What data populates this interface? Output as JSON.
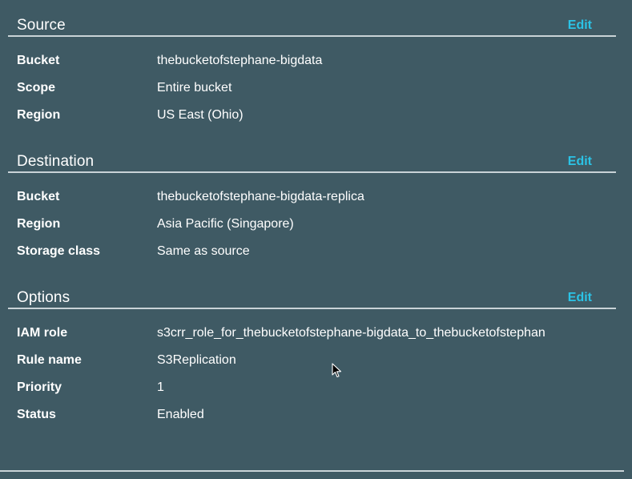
{
  "source": {
    "title": "Source",
    "edit_label": "Edit",
    "rows": [
      {
        "label": "Bucket",
        "value": "thebucketofstephane-bigdata"
      },
      {
        "label": "Scope",
        "value": "Entire bucket"
      },
      {
        "label": "Region",
        "value": "US East (Ohio)"
      }
    ]
  },
  "destination": {
    "title": "Destination",
    "edit_label": "Edit",
    "rows": [
      {
        "label": "Bucket",
        "value": "thebucketofstephane-bigdata-replica"
      },
      {
        "label": "Region",
        "value": "Asia Pacific (Singapore)"
      },
      {
        "label": "Storage class",
        "value": "Same as source"
      }
    ]
  },
  "options": {
    "title": "Options",
    "edit_label": "Edit",
    "rows": [
      {
        "label": "IAM role",
        "value": "s3crr_role_for_thebucketofstephane-bigdata_to_thebucketofstephan"
      },
      {
        "label": "Rule name",
        "value": "S3Replication"
      },
      {
        "label": "Priority",
        "value": "1"
      },
      {
        "label": "Status",
        "value": "Enabled"
      }
    ]
  },
  "colors": {
    "background": "#3f5a64",
    "accent_link": "#2bc3e6",
    "divider": "#c9d3d7",
    "text": "#ffffff"
  },
  "icons": {
    "cursor": "mouse-pointer-icon"
  }
}
